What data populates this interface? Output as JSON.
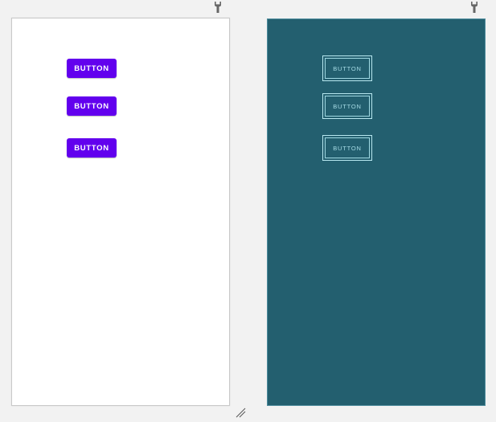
{
  "design": {
    "buttons": [
      {
        "label": "BUTTON"
      },
      {
        "label": "BUTTON"
      },
      {
        "label": "BUTTON"
      }
    ]
  },
  "blueprint": {
    "buttons": [
      {
        "label": "BUTTON"
      },
      {
        "label": "BUTTON"
      },
      {
        "label": "BUTTON"
      }
    ]
  },
  "icons": {
    "design_pin": "wrench-icon",
    "blueprint_pin": "wrench-icon",
    "resize": "resize-handle-icon"
  },
  "colors": {
    "button_bg": "#6200ee",
    "blueprint_bg": "#235f6f",
    "blueprint_line": "#b7e7ef"
  }
}
